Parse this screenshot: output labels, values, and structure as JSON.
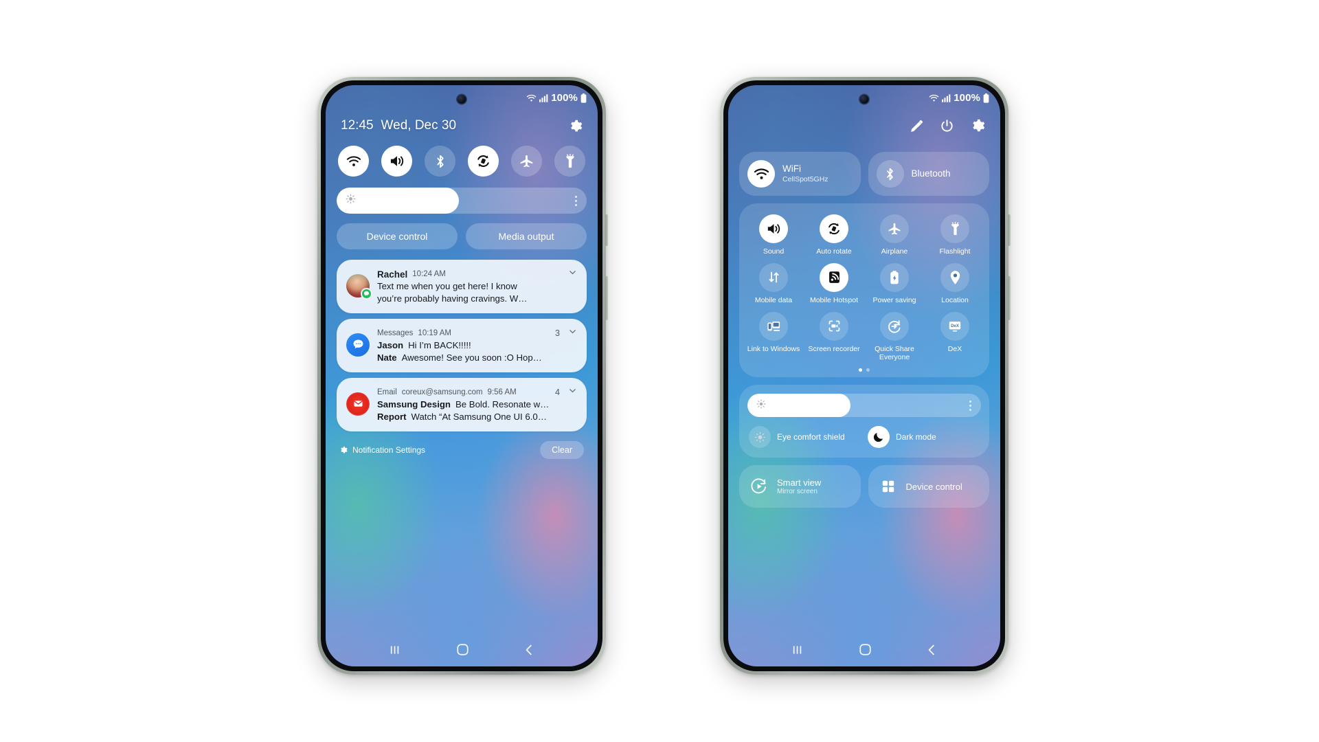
{
  "status_bar": {
    "battery": "100%",
    "wifi_icon": "wifi-icon",
    "signal_icon": "cellular-signal-icon",
    "battery_icon": "battery-icon"
  },
  "left_phone": {
    "header": {
      "time": "12:45",
      "date": "Wed, Dec 30",
      "settings_icon": "gear-icon"
    },
    "quick_toggles": [
      {
        "name": "wifi",
        "icon": "wifi-icon",
        "on": true
      },
      {
        "name": "sound",
        "icon": "volume-icon",
        "on": true
      },
      {
        "name": "bluetooth",
        "icon": "bluetooth-icon",
        "on": false
      },
      {
        "name": "auto-rotate",
        "icon": "auto-rotate-icon",
        "on": true
      },
      {
        "name": "airplane",
        "icon": "airplane-icon",
        "on": false
      },
      {
        "name": "flashlight",
        "icon": "flashlight-icon",
        "on": false
      }
    ],
    "brightness": {
      "icon": "brightness-sun-icon",
      "value": 49,
      "menu_icon": "more-vertical-icon"
    },
    "pills": [
      {
        "label": "Device control",
        "name": "device-control"
      },
      {
        "label": "Media output",
        "name": "media-output"
      }
    ],
    "notifications": [
      {
        "sender": "Rachel",
        "time": "10:24 AM",
        "count": "",
        "avatar": "contact-photo",
        "badge": "messages-badge-icon",
        "lines": [
          {
            "bold": "",
            "text": "Text me when you get here! I know"
          },
          {
            "bold": "",
            "text": "you’re probably having cravings. W…"
          }
        ]
      },
      {
        "sender": "",
        "app": "Messages",
        "time": "10:19 AM",
        "count": "3",
        "avatar": "messages-app-icon",
        "lines": [
          {
            "bold": "Jason",
            "text": "Hi I’m BACK!!!!!"
          },
          {
            "bold": "Nate",
            "text": "Awesome! See you soon :O Hop…"
          }
        ]
      },
      {
        "sender": "",
        "app": "Email",
        "address": "coreux@samsung.com",
        "time": "9:56 AM",
        "count": "4",
        "avatar": "email-app-icon",
        "lines": [
          {
            "bold": "Samsung Design",
            "text": "Be Bold. Resonate w…"
          },
          {
            "bold": "Report",
            "text": "Watch “At Samsung One UI 6.0…"
          }
        ]
      }
    ],
    "footer": {
      "settings_label": "Notification Settings",
      "settings_icon": "gear-icon",
      "clear_label": "Clear"
    }
  },
  "right_phone": {
    "header_icons": [
      {
        "name": "edit-pencil-icon"
      },
      {
        "name": "power-icon"
      },
      {
        "name": "gear-icon"
      }
    ],
    "connection_pills": [
      {
        "name": "wifi",
        "title": "WiFi",
        "subtitle": "CellSpot5GHz",
        "icon": "wifi-icon",
        "on": true
      },
      {
        "name": "bluetooth",
        "title": "Bluetooth",
        "subtitle": "",
        "icon": "bluetooth-icon",
        "on": false
      }
    ],
    "tiles": [
      {
        "label": "Sound",
        "icon": "volume-icon",
        "on": true
      },
      {
        "label": "Auto rotate",
        "icon": "auto-rotate-icon",
        "on": true
      },
      {
        "label": "Airplane",
        "icon": "airplane-icon",
        "on": false
      },
      {
        "label": "Flashlight",
        "icon": "flashlight-icon",
        "on": false
      },
      {
        "label": "Mobile data",
        "icon": "mobile-data-icon",
        "on": false
      },
      {
        "label": "Mobile Hotspot",
        "icon": "hotspot-icon",
        "on": true
      },
      {
        "label": "Power saving",
        "icon": "battery-saver-icon",
        "on": false
      },
      {
        "label": "Location",
        "icon": "location-pin-icon",
        "on": false
      },
      {
        "label": "Link to Windows",
        "icon": "link-to-windows-icon",
        "on": false
      },
      {
        "label": "Screen recorder",
        "icon": "screen-recorder-icon",
        "on": false
      },
      {
        "label": "Quick Share Everyone",
        "icon": "quick-share-icon",
        "on": false
      },
      {
        "label": "DeX",
        "icon": "dex-icon",
        "on": false
      }
    ],
    "page_dots": {
      "total": 2,
      "active": 0
    },
    "brightness": {
      "icon": "brightness-sun-icon",
      "value": 44,
      "menu_icon": "more-vertical-icon"
    },
    "modes": [
      {
        "label": "Eye comfort shield",
        "icon": "eye-comfort-icon",
        "on": false
      },
      {
        "label": "Dark mode",
        "icon": "moon-icon",
        "on": true
      }
    ],
    "bottom": [
      {
        "title": "Smart view",
        "subtitle": "Mirror screen",
        "icon": "smart-view-icon"
      },
      {
        "title": "Device control",
        "subtitle": "",
        "icon": "grid-icon"
      }
    ]
  },
  "nav_bar": {
    "recents": "recents-icon",
    "home": "home-icon",
    "back": "back-icon"
  }
}
